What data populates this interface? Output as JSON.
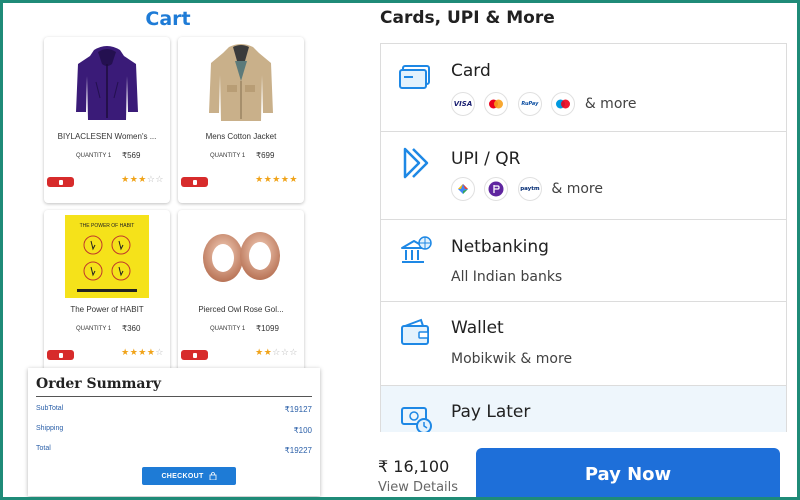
{
  "cart": {
    "title": "Cart",
    "items": [
      {
        "name": "BIYLACLESEN Women's ...",
        "qty_label": "QUANTITY 1",
        "price": "₹569",
        "rating": 3
      },
      {
        "name": "Mens Cotton Jacket",
        "qty_label": "QUANTITY 1",
        "price": "₹699",
        "rating": 5
      },
      {
        "name": "The Power of HABIT",
        "qty_label": "QUANTITY 1",
        "price": "₹360",
        "rating": 4
      },
      {
        "name": "Pierced Owl Rose Gol...",
        "qty_label": "QUANTITY 1",
        "price": "₹1099",
        "rating": 2
      }
    ],
    "book_cover_text": "THE POWER OF HABIT"
  },
  "order_summary": {
    "title": "Order Summary",
    "subtotal_label": "SubTotal",
    "subtotal_value": "₹19127",
    "shipping_label": "Shipping",
    "shipping_value": "₹100",
    "total_label": "Total",
    "total_value": "₹19227",
    "checkout_label": "CHECKOUT"
  },
  "payment": {
    "heading": "Cards, UPI & More",
    "methods": [
      {
        "title": "Card",
        "subtitle": "& more",
        "icon": "card-icon",
        "brands": [
          "VISA",
          "Mastercard",
          "RuPay",
          "Maestro"
        ]
      },
      {
        "title": "UPI / QR",
        "subtitle": "& more",
        "icon": "upi-icon",
        "brands": [
          "Google Pay",
          "PhonePe",
          "Paytm"
        ]
      },
      {
        "title": "Netbanking",
        "subtitle": "All Indian banks",
        "icon": "bank-icon"
      },
      {
        "title": "Wallet",
        "subtitle": "Mobikwik & more",
        "icon": "wallet-icon"
      },
      {
        "title": "Pay Later",
        "subtitle": "",
        "icon": "pay-later-icon"
      }
    ],
    "brand_labels": {
      "visa": "VISA",
      "rupay": "RuPay",
      "paytm": "paytm"
    },
    "total": "₹ 16,100",
    "view_details": "View Details",
    "pay_now": "Pay Now"
  },
  "colors": {
    "accent": "#1e7bd6",
    "remove": "#d72b2b",
    "star": "#f0a319",
    "frame": "#1f8b78"
  }
}
